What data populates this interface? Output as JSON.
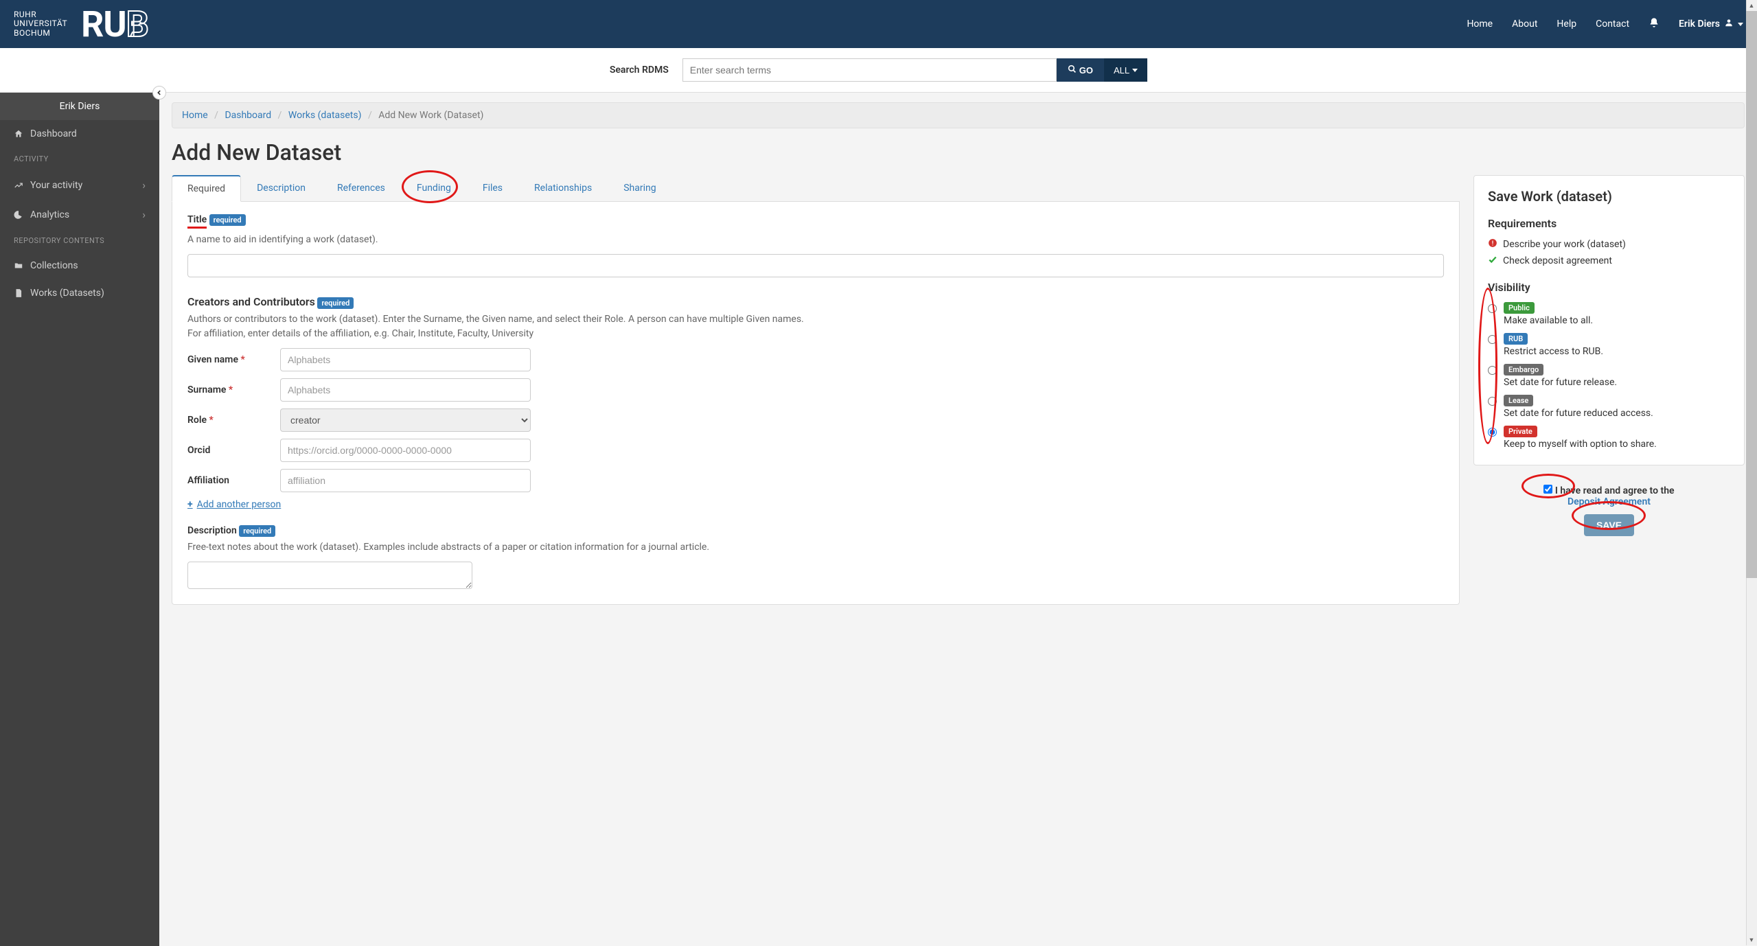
{
  "header": {
    "uni_line1": "RUHR",
    "uni_line2": "UNIVERSITÄT",
    "uni_line3": "BOCHUM",
    "rub_r": "R",
    "rub_u": "U",
    "rub_b": "B",
    "nav": {
      "home": "Home",
      "about": "About",
      "help": "Help",
      "contact": "Contact"
    },
    "user": "Erik Diers"
  },
  "search": {
    "label": "Search RDMS",
    "placeholder": "Enter search terms",
    "go": "GO",
    "all": "ALL"
  },
  "sidebar": {
    "user": "Erik Diers",
    "dashboard": "Dashboard",
    "activity_heading": "ACTIVITY",
    "your_activity": "Your activity",
    "analytics": "Analytics",
    "repo_heading": "REPOSITORY CONTENTS",
    "collections": "Collections",
    "works": "Works (Datasets)"
  },
  "breadcrumb": {
    "home": "Home",
    "dashboard": "Dashboard",
    "works": "Works (datasets)",
    "current": "Add New Work (Dataset)"
  },
  "page_title": "Add New Dataset",
  "tabs": {
    "required": "Required",
    "description": "Description",
    "references": "References",
    "funding": "Funding",
    "files": "Files",
    "relationships": "Relationships",
    "sharing": "Sharing"
  },
  "form": {
    "title_label": "Title",
    "required_badge": "required",
    "title_help": "A name to aid in identifying a work (dataset).",
    "creators_label": "Creators and Contributors",
    "creators_help1": "Authors or contributors to the work (dataset). Enter the Surname, the Given name, and select their Role. A person can have multiple Given names.",
    "creators_help2": "For affiliation, enter details of the affiliation, e.g. Chair, Institute, Faculty, University",
    "given_name": "Given name",
    "surname": "Surname",
    "role": "Role",
    "role_value": "creator",
    "orcid": "Orcid",
    "orcid_placeholder": "https://orcid.org/0000-0000-0000-0000",
    "affiliation": "Affiliation",
    "affiliation_placeholder": "affiliation",
    "alphabets_placeholder": "Alphabets",
    "add_person": "Add another person",
    "description_label": "Description",
    "description_help": "Free-text notes about the work (dataset). Examples include abstracts of a paper or citation information for a journal article."
  },
  "right": {
    "heading": "Save Work (dataset)",
    "requirements": "Requirements",
    "req1": "Describe your work (dataset)",
    "req2": "Check deposit agreement",
    "visibility": "Visibility",
    "public": "Public",
    "public_desc": "Make available to all.",
    "rub": "RUB",
    "rub_desc": "Restrict access to RUB.",
    "embargo": "Embargo",
    "embargo_desc": "Set date for future release.",
    "lease": "Lease",
    "lease_desc": "Set date for future reduced access.",
    "private": "Private",
    "private_desc": "Keep to myself with option to share.",
    "agreement_text": "I have read and agree to the",
    "agreement_link": "Deposit Agreement",
    "save": "SAVE"
  }
}
